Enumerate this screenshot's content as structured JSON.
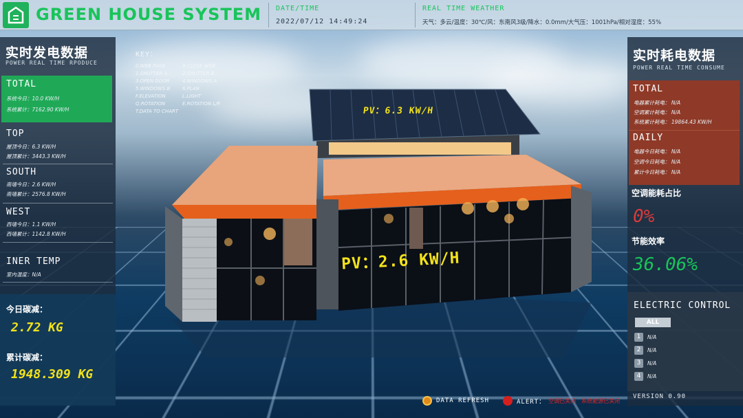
{
  "header": {
    "title": "GREEN HOUSE SYSTEM",
    "datetime_label": "DATE/TIME",
    "datetime_value": "2022/07/12  14:49:24",
    "weather_label": "REAL TIME WEATHER",
    "weather_value": "天气：多云/温度：30℃/风：东南风3级/降水：0.0mm/大气压：1001hPa/相对湿度：55%"
  },
  "left": {
    "title_cn": "实时发电数据",
    "title_en": "POWER REAL TIME RPODUCE",
    "total": {
      "head": "TOTAL",
      "rows": [
        {
          "label": "系统今日：",
          "value": "10.0 KW/H"
        },
        {
          "label": "系统累计：",
          "value": "7162.90 KW/H"
        }
      ]
    },
    "top": {
      "head": "TOP",
      "rows": [
        {
          "label": "屋顶今日：",
          "value": "6.3 KW/H"
        },
        {
          "label": "屋顶累计：",
          "value": "3443.3 KW/H"
        }
      ]
    },
    "south": {
      "head": "SOUTH",
      "rows": [
        {
          "label": "南墙今日：",
          "value": "2.6 KW/H"
        },
        {
          "label": "南墙累计：",
          "value": "2576.8 KW/H"
        }
      ]
    },
    "west": {
      "head": "WEST",
      "rows": [
        {
          "label": "西墙今日：",
          "value": "1.1 KW/H"
        },
        {
          "label": "西墙累计：",
          "value": "1142.8 KW/H"
        }
      ]
    },
    "inner": {
      "head": "INER TEMP",
      "rows": [
        {
          "label": "室内温度：",
          "value": "N/A"
        }
      ]
    },
    "carbon_today_label": "今日碳减：",
    "carbon_today_value": "2.72 KG",
    "carbon_total_label": "累计碳减：",
    "carbon_total_value": "1948.309 KG"
  },
  "key": {
    "title": "KEY：",
    "rows": [
      [
        "0.WEB PAGE",
        "9.CLOSE WEB"
      ],
      [
        "1.SHUTTER A",
        "2.SHUTTER B"
      ],
      [
        "3.OPEN DOOR",
        "4.WINDOWS A"
      ],
      [
        "5.WINDOWS B",
        "6.PLAN"
      ],
      [
        "F.ELEVATION",
        "L.LIGHT"
      ],
      [
        "Q.ROTATION",
        "E.ROTATION L/R"
      ],
      [
        "T.DATA TO CHART",
        ""
      ]
    ]
  },
  "scene": {
    "roof_pv": "PV：6.3 KW/H",
    "wall_pv": "PV：2.6 KW/H"
  },
  "right": {
    "title_cn": "实时耗电数据",
    "title_en": "POWER REAL TIME CONSUME",
    "total": {
      "head": "TOTAL",
      "rows": [
        {
          "label": "电器累计耗电：",
          "value": "N/A"
        },
        {
          "label": "空调累计耗电：",
          "value": "N/A"
        },
        {
          "label": "系统累计耗电：",
          "value": "19864.43 KW/H"
        }
      ]
    },
    "daily": {
      "head": "DAILY",
      "rows": [
        {
          "label": "电器今日耗电：",
          "value": "N/A"
        },
        {
          "label": "空调今日耗电：",
          "value": "N/A"
        },
        {
          "label": "累计今日耗电：",
          "value": "N/A"
        }
      ]
    },
    "ac_ratio_label": "空调能耗占比",
    "ac_ratio_value": "0%",
    "efficiency_label": "节能效率",
    "efficiency_value": "36.06%",
    "control_title": "ELECTRIC CONTROL",
    "control_all": "ALL",
    "controls": [
      {
        "num": "1",
        "value": "N/A"
      },
      {
        "num": "2",
        "value": "N/A"
      },
      {
        "num": "3",
        "value": "N/A"
      },
      {
        "num": "4",
        "value": "N/A"
      }
    ],
    "version": "VERSION 0.90"
  },
  "footer": {
    "refresh": "DATA REFRESH",
    "alert": "ALERT：",
    "alert_msg1": "空调已关闭",
    "alert_msg2": "系统能源已关闭"
  },
  "colors": {
    "accent_green": "#18c45a",
    "highlight_green": "#1fb15b",
    "consume_red": "#8f3a28",
    "warning_red": "#d93a3a",
    "value_yellow": "#f3e21a"
  }
}
